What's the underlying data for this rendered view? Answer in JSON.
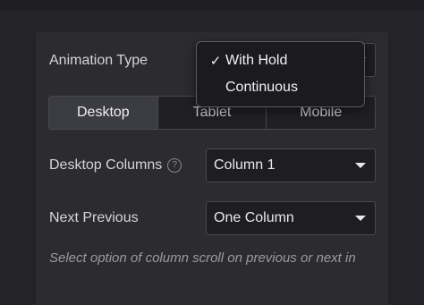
{
  "animation_type": {
    "label": "Animation Type",
    "options": [
      {
        "label": "With Hold",
        "selected": true
      },
      {
        "label": "Continuous",
        "selected": false
      }
    ],
    "check_glyph": "✓"
  },
  "device_tabs": [
    "Desktop",
    "Tablet",
    "Mobile"
  ],
  "desktop_columns": {
    "label": "Desktop Columns",
    "help_glyph": "?",
    "value": "Column 1"
  },
  "next_previous": {
    "label": "Next Previous",
    "value": "One Column"
  },
  "description": "Select option of column scroll on previous or next in"
}
